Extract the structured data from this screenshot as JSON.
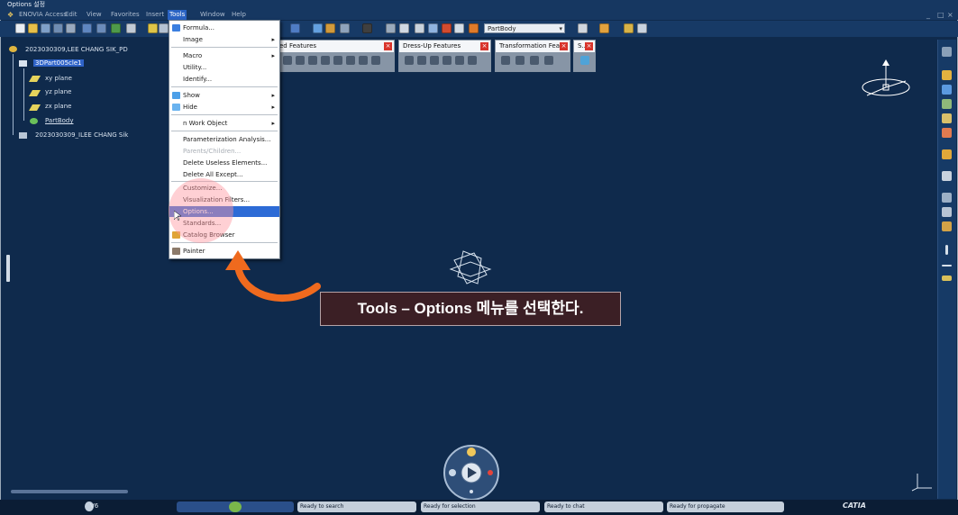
{
  "window": {
    "title": "Options 설정"
  },
  "menu_bar": {
    "items": [
      {
        "label": "ENOVIA Access"
      },
      {
        "label": "Edit"
      },
      {
        "label": "View"
      },
      {
        "label": "Favorites"
      },
      {
        "label": "Insert"
      },
      {
        "label": "Tools"
      },
      {
        "label": "Window"
      },
      {
        "label": "Help"
      }
    ]
  },
  "toolbar": {
    "body_combo_value": "PartBody"
  },
  "spec_tree": {
    "root": "2023030309,LEE CHANG SIK_PD",
    "part": "3DPart005cle1",
    "xy": "xy plane",
    "yz": "yz plane",
    "zx": "zx plane",
    "body": "PartBody",
    "product": "2023030309_ILEE CHANG Sik"
  },
  "floating_toolbars": [
    {
      "title": "ed Features"
    },
    {
      "title": "Dress-Up Features"
    },
    {
      "title": "Transformation Feat..."
    },
    {
      "title": "S..."
    }
  ],
  "tools_menu": {
    "items": [
      {
        "label": "Formula...",
        "submenu": false,
        "disabled": false
      },
      {
        "label": "Image",
        "submenu": true,
        "disabled": false
      },
      {
        "label": "Macro",
        "submenu": true,
        "disabled": false
      },
      {
        "label": "Utility...",
        "submenu": false,
        "disabled": false
      },
      {
        "label": "Identify...",
        "submenu": false,
        "disabled": false
      },
      {
        "label": "Show",
        "submenu": true,
        "disabled": false
      },
      {
        "label": "Hide",
        "submenu": true,
        "disabled": false
      },
      {
        "label": "n Work Object",
        "submenu": true,
        "disabled": false
      },
      {
        "label": "Parameterization Analysis...",
        "submenu": false,
        "disabled": false
      },
      {
        "label": "Parents/Children...",
        "submenu": false,
        "disabled": true
      },
      {
        "label": "Delete Useless Elements...",
        "submenu": false,
        "disabled": false
      },
      {
        "label": "Delete All Except...",
        "submenu": false,
        "disabled": false
      },
      {
        "label": "Customize...",
        "submenu": false,
        "disabled": false
      },
      {
        "label": "Visualization Filters...",
        "submenu": false,
        "disabled": false
      },
      {
        "label": "Options...",
        "submenu": false,
        "disabled": false
      },
      {
        "label": "Standards...",
        "submenu": false,
        "disabled": false
      },
      {
        "label": "Catalog Browser",
        "submenu": false,
        "disabled": false
      },
      {
        "label": "Painter",
        "submenu": false,
        "disabled": false
      }
    ]
  },
  "callout": {
    "text": "Tools – Options 메뉴를 선택한다."
  },
  "taskbar": {
    "v6": "V6",
    "search": "Ready to search",
    "selection": "Ready for selection",
    "chat": "Ready to chat",
    "propagate": "Ready for propagate",
    "brand": "CATIA"
  },
  "colors": {
    "background": "#0f2a4c",
    "menu_highlight": "#2d6bd6",
    "callout_bg": "#3b1f25",
    "arrow": "#ef6a1e"
  }
}
